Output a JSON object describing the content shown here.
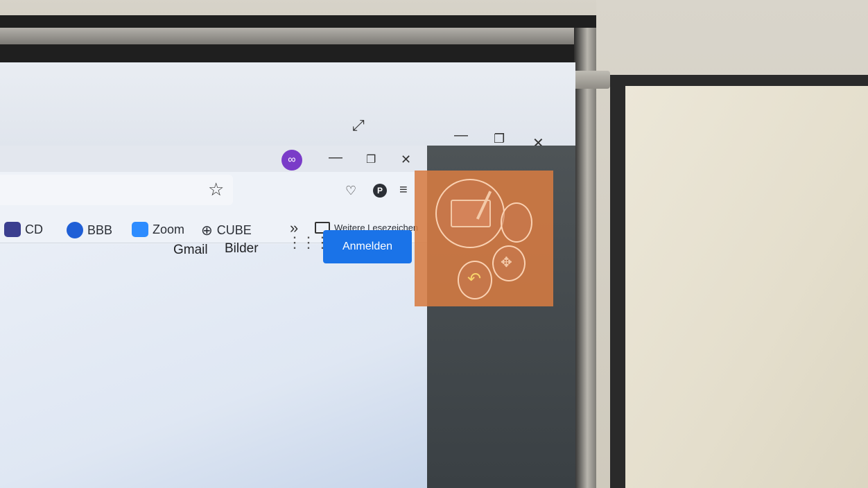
{
  "window_controls": {
    "outer": {
      "minimize": "—",
      "restore": "❐",
      "close": "✕",
      "expand": "⤢"
    },
    "inner": {
      "minimize": "—",
      "restore": "❐",
      "close": "✕"
    }
  },
  "browser": {
    "toolbar": {
      "star": "☆",
      "pocket": "♡",
      "profile": "P",
      "menu": "≡"
    },
    "bookmarks": [
      {
        "label": "CD",
        "color": "#3b3f8f"
      },
      {
        "label": "BBB",
        "color": "#1f5fd6"
      },
      {
        "label": "Zoom",
        "color": "#2d8cff"
      },
      {
        "label": "CUBE",
        "color": "#2b2f36"
      }
    ],
    "chevron": "»",
    "other_bookmarks": "Weitere Lesezeichen"
  },
  "google_header": {
    "gmail": "Gmail",
    "images": "Bilder",
    "signin": "Anmelden"
  },
  "colors": {
    "signin_button": "#1a73e8",
    "overlay": "#d67b42",
    "private_icon": "#7a3cc8"
  }
}
